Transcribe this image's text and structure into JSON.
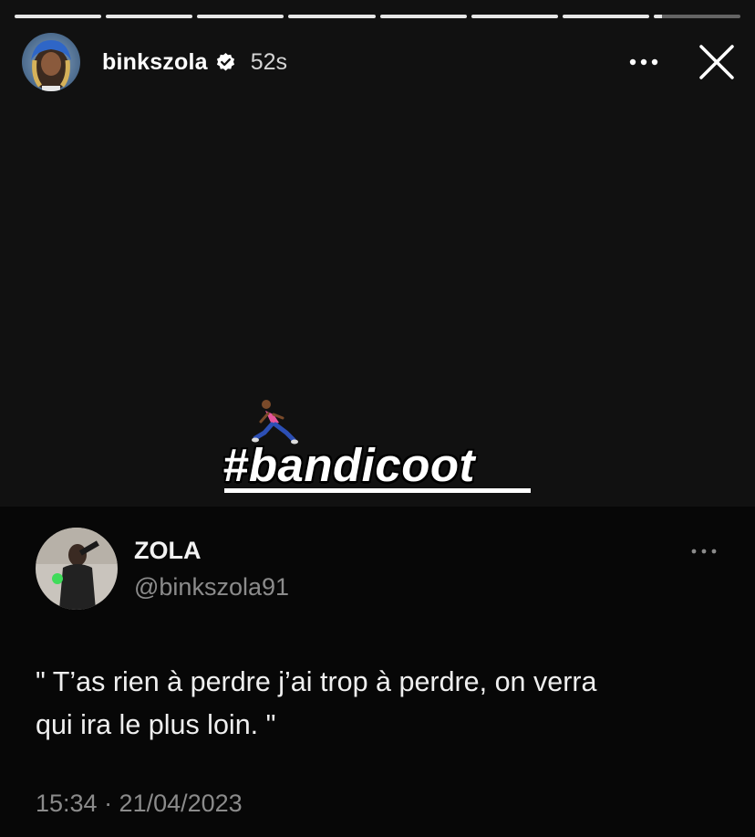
{
  "progress": {
    "segments": 8,
    "completed": 7,
    "current_fill": 0.1
  },
  "header": {
    "username": "binkszola",
    "verified": true,
    "time_ago": "52s"
  },
  "sticker": {
    "emoji_icon": "running-person-icon",
    "hashtag": "#bandicoot"
  },
  "tweet": {
    "name": "ZOLA",
    "handle": "@binkszola91",
    "text_line1": "\" T’as rien à perdre j’ai trop à perdre, on verra",
    "text_line2": "qui ira le plus loin. \"",
    "timestamp": "15:34 · 21/04/2023"
  },
  "colors": {
    "background": "#111111",
    "tweet_background": "#070707",
    "secondary_text": "#8b8b8b"
  }
}
